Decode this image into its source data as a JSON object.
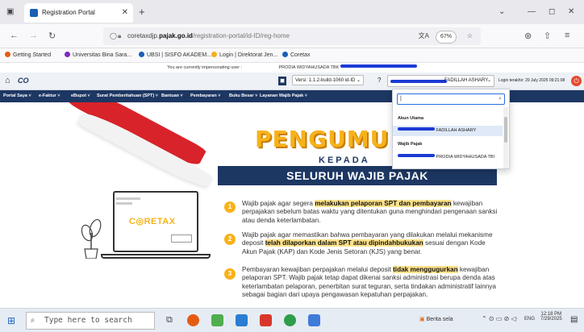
{
  "browser": {
    "tab_title": "Registration Portal",
    "url_prefix": "coretaxdjp.",
    "url_domain": "pajak.go.id",
    "url_path": "/registration-portal/id-ID/reg-home",
    "zoom": "67%"
  },
  "bookmarks": [
    {
      "label": "Getting Started",
      "color": "#e55b13"
    },
    {
      "label": "Universitas Bina Sara...",
      "color": "#7b2cbf"
    },
    {
      "label": "UBSI | SISFO AKADEM...",
      "color": "#1a5fb4"
    },
    {
      "label": "Login | Direktorat Jen...",
      "color": "#f2b01e"
    },
    {
      "label": "Coretax",
      "color": "#1a5fb4"
    }
  ],
  "impersonation": {
    "text": "You are currently impersonating user : ",
    "name_visible": "PRODIA WIDYAHUSADA TBK"
  },
  "appbar": {
    "logo_text": "CO",
    "version": "Versi: 1.1.2-build-1060",
    "lang": "id-ID",
    "user_name_visible": "FADILLAH ASHARY",
    "last_login": "Login terakhir: 29 July 2025 09:21:08"
  },
  "menu": [
    "Portal Saya",
    "e-Faktur",
    "eBupot",
    "Surat Pemberitahuan (SPT)",
    "Bantuan",
    "Pembayaran",
    "Buku Besar",
    "Layanan Wajib Pajak"
  ],
  "dropdown": {
    "group1_label": "Akun Utama",
    "group1_item_visible": "FADILLAH ASHARY",
    "group2_label": "Wajib Pajak",
    "group2_item_visible": "PRODIA WIDYAHUSADA TBI"
  },
  "announcement": {
    "title": "PENGUMU",
    "subtitle": "KEPADA",
    "band": "SELURUH WAJIB PAJAK",
    "logo_left": "C",
    "logo_right": "RETAX",
    "items": [
      {
        "num": "1",
        "pre": "Wajib pajak agar segera ",
        "highlight": "melakukan pelaporan SPT dan pembayaran",
        "post": " kewajiban perpajakan sebelum batas waktu yang ditentukan guna menghindari pengenaan sanksi atau denda keterlambatan."
      },
      {
        "num": "2",
        "pre": "Wajib pajak agar memastikan bahwa pembayaran yang dilakukan melalui mekanisme deposit ",
        "highlight": "telah dilaporkan dalam SPT atau dipindahbukukan",
        "post": " sesuai dengan Kode Akun Pajak (KAP) dan Kode Jenis Setoran (KJS) yang benar."
      },
      {
        "num": "3",
        "pre": "Pembayaran kewajiban perpajakan melalui deposit ",
        "highlight": "tidak menggugurkan",
        "post": " kewajiban pelaporan SPT. Wajib pajak tetap dapat dikenai sanksi administrasi berupa denda atas keterlambatan pelaporan, penerbitan surat teguran, serta tindakan administratif lainnya sebagai bagian dari upaya pengawasan kepatuhan perpajakan."
      }
    ]
  },
  "taskbar": {
    "search_placeholder": "Type here to search",
    "news": "Berita sela",
    "lang": "ENG",
    "time": "12:18 PM",
    "date": "7/29/2025"
  },
  "colors": {
    "navy": "#1d3763",
    "gold": "#f7b21a",
    "red": "#d8232a",
    "redact_blue": "#1c3bd6"
  }
}
